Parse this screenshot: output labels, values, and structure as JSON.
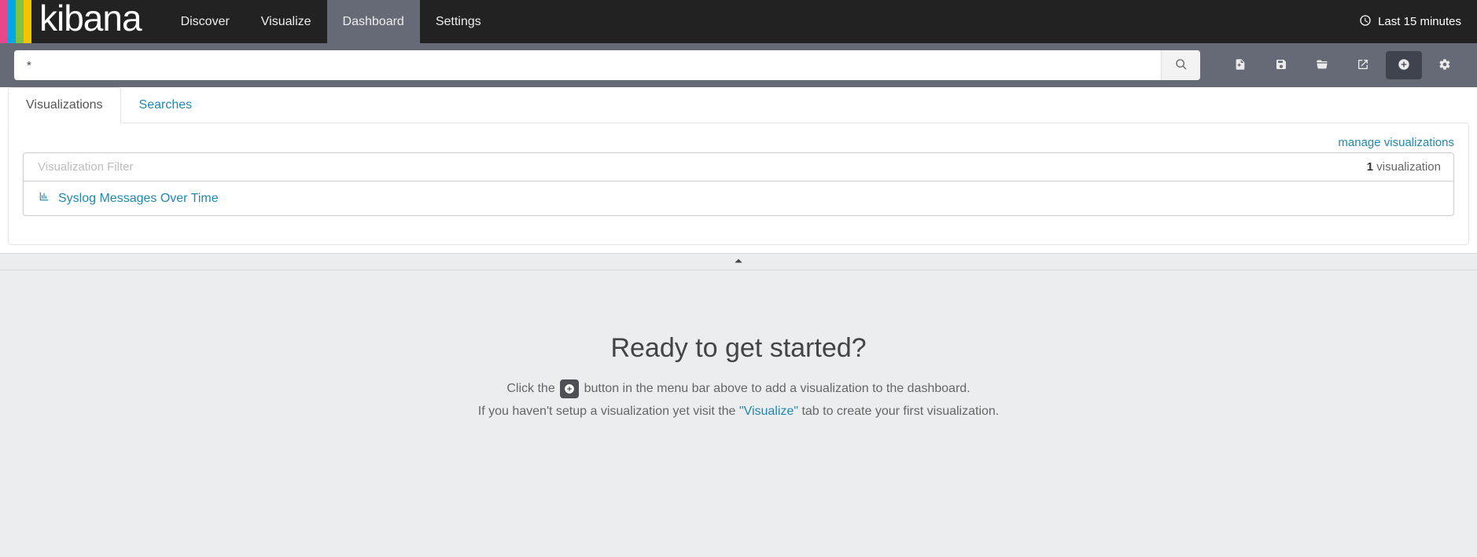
{
  "logo": {
    "text": "kibana"
  },
  "nav": {
    "discover": "Discover",
    "visualize": "Visualize",
    "dashboard": "Dashboard",
    "settings": "Settings"
  },
  "time": {
    "label": "Last 15 minutes"
  },
  "search": {
    "value": "*"
  },
  "tabs": {
    "visualizations": "Visualizations",
    "searches": "Searches"
  },
  "manage_link": "manage visualizations",
  "filter": {
    "placeholder": "Visualization Filter"
  },
  "count": {
    "n": "1",
    "suffix": " visualization"
  },
  "items": [
    {
      "label": "Syslog Messages Over Time"
    }
  ],
  "empty": {
    "heading": "Ready to get started?",
    "line1a": "Click the ",
    "line1b": " button in the menu bar above to add a visualization to the dashboard.",
    "line2a": "If you haven't setup a visualization yet visit the ",
    "line2_link": "\"Visualize\"",
    "line2b": " tab to create your first visualization."
  }
}
